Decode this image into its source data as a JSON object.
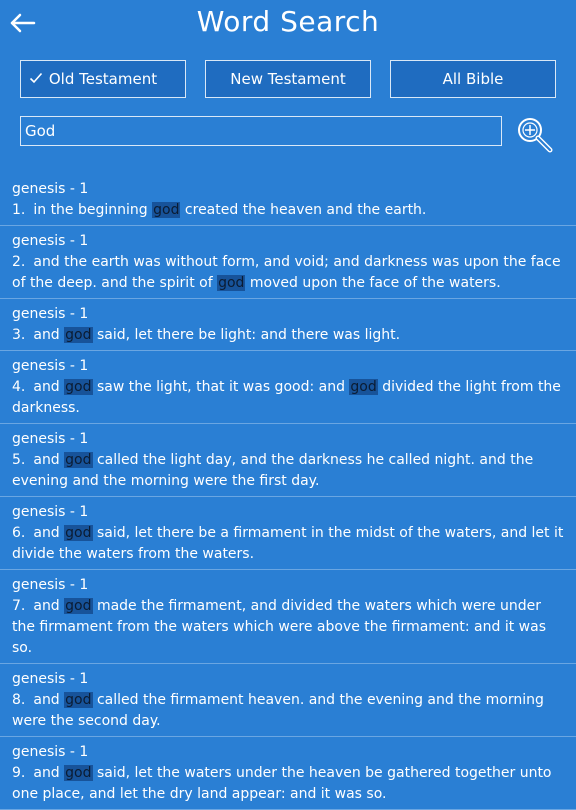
{
  "header": {
    "title": "Word Search"
  },
  "tabs": [
    {
      "label": "Old Testament",
      "selected": true
    },
    {
      "label": "New Testament",
      "selected": false
    },
    {
      "label": "All Bible",
      "selected": false
    }
  ],
  "search": {
    "value": "God"
  },
  "highlight_color": "#17539a",
  "results": [
    {
      "ref": "genesis - 1",
      "num": "1.",
      "parts": [
        "in the beginning ",
        "god",
        " created the heaven and the earth."
      ]
    },
    {
      "ref": "genesis - 1",
      "num": "2.",
      "parts": [
        "and the earth was without form, and void; and darkness was upon the face of the deep. and the spirit of ",
        "god",
        " moved upon the face of the waters."
      ]
    },
    {
      "ref": "genesis - 1",
      "num": "3.",
      "parts": [
        "and ",
        "god",
        " said, let there be light: and there was light."
      ]
    },
    {
      "ref": "genesis - 1",
      "num": "4.",
      "parts": [
        "and ",
        "god",
        " saw the light, that it was good: and ",
        "god",
        " divided the light from the darkness."
      ]
    },
    {
      "ref": "genesis - 1",
      "num": "5.",
      "parts": [
        "and ",
        "god",
        " called the light day, and the darkness he called night. and the evening and the morning were the first day."
      ]
    },
    {
      "ref": "genesis - 1",
      "num": "6.",
      "parts": [
        "and ",
        "god",
        " said, let there be a firmament in the midst of the waters, and let it divide the waters from the waters."
      ]
    },
    {
      "ref": "genesis - 1",
      "num": "7.",
      "parts": [
        "and ",
        "god",
        " made the firmament, and divided the waters which were under the firmament from the waters which were above the firmament: and it was so."
      ]
    },
    {
      "ref": "genesis - 1",
      "num": "8.",
      "parts": [
        "and ",
        "god",
        " called the firmament heaven. and the evening and the morning were the second day."
      ]
    },
    {
      "ref": "genesis - 1",
      "num": "9.",
      "parts": [
        "and ",
        "god",
        " said, let the waters under the heaven be gathered together unto one place, and let the dry land appear: and it was so."
      ]
    }
  ]
}
